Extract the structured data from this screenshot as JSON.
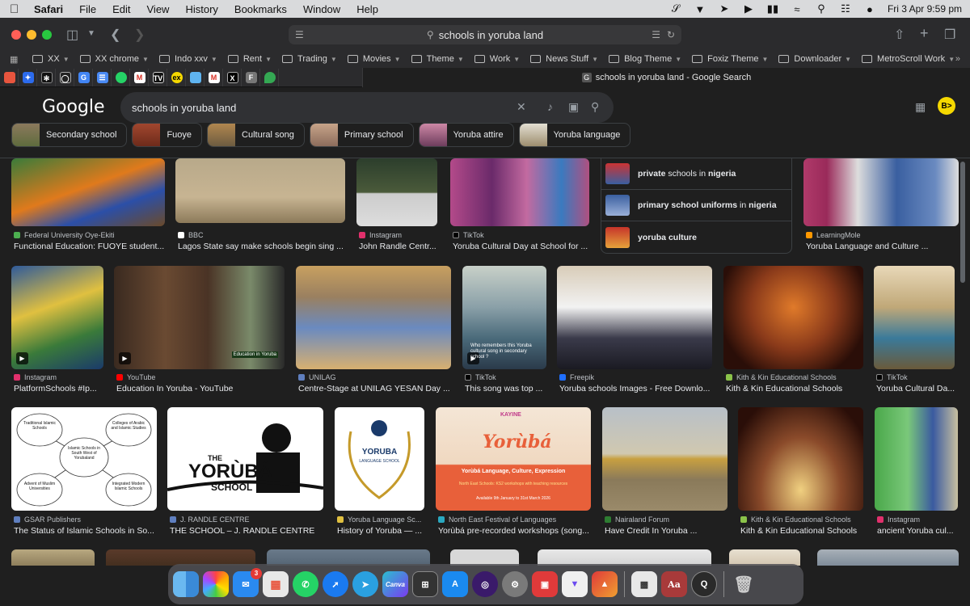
{
  "menubar": {
    "app": "Safari",
    "items": [
      "File",
      "Edit",
      "View",
      "History",
      "Bookmarks",
      "Window",
      "Help"
    ],
    "clock": "Fri 3 Apr  9:59 pm"
  },
  "safari": {
    "address": "schools in yoruba land",
    "favorites": [
      {
        "label": "XX"
      },
      {
        "label": "XX chrome"
      },
      {
        "label": "Indo xxv"
      },
      {
        "label": "Rent"
      },
      {
        "label": "Trading"
      },
      {
        "label": "Movies"
      },
      {
        "label": "Theme"
      },
      {
        "label": "Work"
      },
      {
        "label": "News Stuff"
      },
      {
        "label": "Blog Theme"
      },
      {
        "label": "Foxiz Theme"
      },
      {
        "label": "Downloader"
      },
      {
        "label": "MetroScroll Work"
      }
    ],
    "active_tab": "schools in yoruba land - Google Search"
  },
  "google": {
    "logo": "Google",
    "query": "schools in yoruba land",
    "avatar": "B>",
    "chips": [
      "Secondary school",
      "Fuoye",
      "Cultural song",
      "Primary school",
      "Yoruba attire",
      "Yoruba language"
    ]
  },
  "related": [
    {
      "bold1": "private",
      "mid": " schools in ",
      "bold2": "nigeria"
    },
    {
      "bold1": "primary school uniforms",
      "mid": " in ",
      "bold2": "nigeria"
    },
    {
      "bold1": "yoruba",
      "mid": " ",
      "bold2": "culture"
    }
  ],
  "results": {
    "row1": [
      {
        "source": "Federal University Oye-Ekiti",
        "title": "Functional Education: FUOYE student..."
      },
      {
        "source": "BBC",
        "title": "Lagos State say make schools begin sing ..."
      },
      {
        "source": "Instagram",
        "title": "John Randle Centr..."
      },
      {
        "source": "TikTok",
        "title": "Yoruba Cultural Day at School for ..."
      },
      {
        "source": "LearningMole",
        "title": "Yoruba Language and Culture ..."
      }
    ],
    "row2": [
      {
        "source": "Instagram",
        "title": "PlatformSchools #Ip..."
      },
      {
        "source": "YouTube",
        "title": "Education In Yoruba - YouTube"
      },
      {
        "source": "UNILAG",
        "title": "Centre-Stage at UNILAG YESAN Day ..."
      },
      {
        "source": "TikTok",
        "title": "This song was top ..."
      },
      {
        "source": "Freepik",
        "title": "Yoruba schools Images - Free Downlo..."
      },
      {
        "source": "Kith & Kin Educational Schools",
        "title": "Kith & Kin Educational Schools"
      },
      {
        "source": "TikTok",
        "title": "Yoruba Cultural Da..."
      }
    ],
    "row3": [
      {
        "source": "GSAR Publishers",
        "title": "The Status of Islamic Schools in So..."
      },
      {
        "source": "J. RANDLE CENTRE",
        "title": "THE SCHOOL – J. RANDLE CENTRE"
      },
      {
        "source": "Yoruba Language Sc...",
        "title": "History of Yoruba — ..."
      },
      {
        "source": "North East Festival of Languages",
        "title": "Yorùbá pre-recorded workshops (song..."
      },
      {
        "source": "Nairaland Forum",
        "title": "Have Credit In Yoruba ..."
      },
      {
        "source": "Kith & Kin Educational Schools",
        "title": "Kith & Kin Educational Schools"
      },
      {
        "source": "Instagram",
        "title": "ancient Yoruba cul..."
      }
    ]
  },
  "image_text": {
    "diagram_nodes": [
      "Traditional Islamic Schools",
      "Islamic Schools in South West of Yorubaland",
      "Colleges of Arabic and Islamic Studies",
      "Advent of Muslim Universities",
      "Integrated Modern Islamic Schools"
    ],
    "the_yoruba_school": [
      "THE",
      "YORÙBÁ",
      "SCHOOL"
    ],
    "yoruba_lang_school": [
      "YORUBA",
      "LANGUAGE SCHOOL"
    ],
    "workshop": [
      "KAYINE",
      "Yorùbá",
      "Yorùbá Language, Culture, Expression",
      "North East Schools: KS2 workshops with teaching resources",
      "Available 9th January to 31st March 2026"
    ],
    "video_caption": "Who remembers this Yoruba cultural song in secondary school ?",
    "youtube_tag": "Education in Yoruba"
  },
  "dock": {
    "mail_badge": "3",
    "canva": "Canva",
    "aa": "Aa"
  }
}
